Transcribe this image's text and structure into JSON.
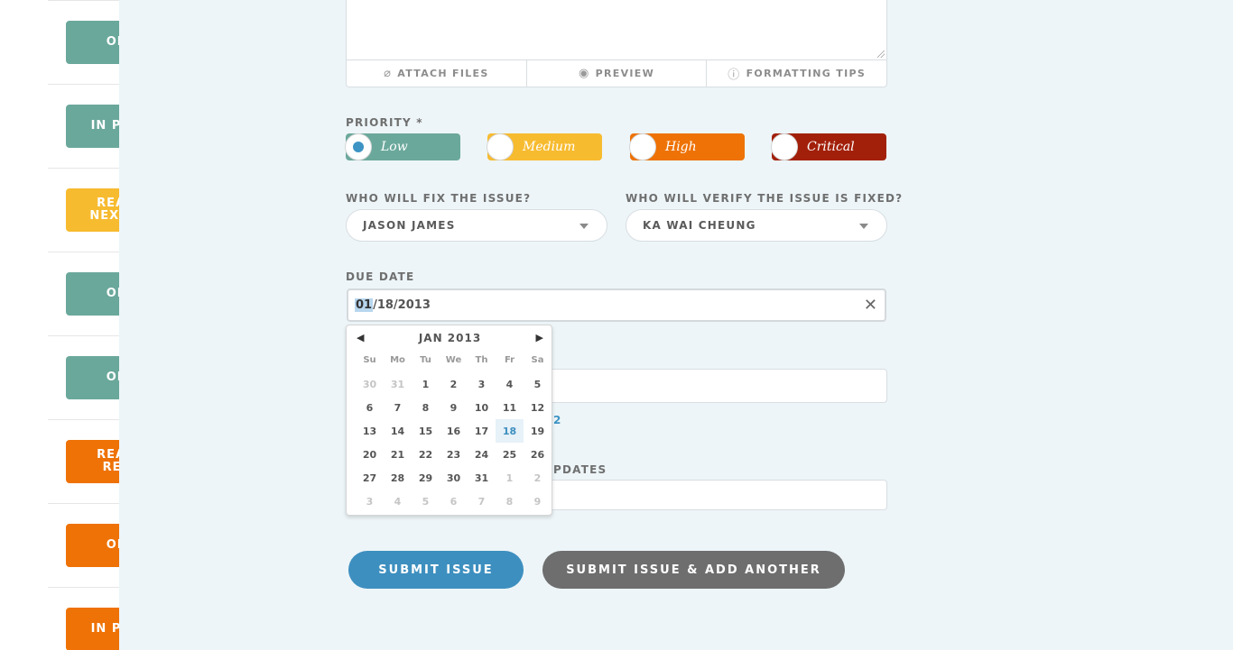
{
  "background_list": [
    {
      "label": "OP",
      "color": "green"
    },
    {
      "label": "IN PRO",
      "color": "green"
    },
    {
      "label": "READ\nNEXT R",
      "color": "yellow"
    },
    {
      "label": "OP",
      "color": "green"
    },
    {
      "label": "OP",
      "color": "green"
    },
    {
      "label": "READ\nRET",
      "color": "orange"
    },
    {
      "label": "OP",
      "color": "orange"
    },
    {
      "label": "IN PRO",
      "color": "orange"
    }
  ],
  "toolbar": {
    "attach": "ATTACH FILES",
    "preview": "PREVIEW",
    "tips": "FORMATTING TIPS"
  },
  "priority": {
    "label": "PRIORITY *",
    "options": [
      "Low",
      "Medium",
      "High",
      "Critical"
    ],
    "selected": "Low"
  },
  "assignee": {
    "label": "WHO WILL FIX THE ISSUE?",
    "value": "JASON JAMES"
  },
  "verifier": {
    "label": "WHO WILL VERIFY THE ISSUE IS FIXED?",
    "value": "KA WAI CHEUNG"
  },
  "due_date": {
    "label": "DUE DATE",
    "selected_part": "01",
    "rest": "/18/2013"
  },
  "fragments": {
    "link_tail": "2",
    "label_tail": "PDATES"
  },
  "datepicker": {
    "title": "JAN 2013",
    "prev": "◀",
    "next": "▶",
    "weekdays": [
      "Su",
      "Mo",
      "Tu",
      "We",
      "Th",
      "Fr",
      "Sa"
    ],
    "weeks": [
      [
        "30",
        "31",
        "1",
        "2",
        "3",
        "4",
        "5"
      ],
      [
        "6",
        "7",
        "8",
        "9",
        "10",
        "11",
        "12"
      ],
      [
        "13",
        "14",
        "15",
        "16",
        "17",
        "18",
        "19"
      ],
      [
        "20",
        "21",
        "22",
        "23",
        "24",
        "25",
        "26"
      ],
      [
        "27",
        "28",
        "29",
        "30",
        "31",
        "1",
        "2"
      ],
      [
        "3",
        "4",
        "5",
        "6",
        "7",
        "8",
        "9"
      ]
    ],
    "selected": "18"
  },
  "buttons": {
    "submit": "SUBMIT ISSUE",
    "submit_add": "SUBMIT ISSUE & ADD ANOTHER"
  },
  "colors": {
    "low": "#6aa89b",
    "medium": "#f7bb30",
    "high": "#ee7205",
    "critical": "#a2200a",
    "primary": "#3d8fbf"
  }
}
